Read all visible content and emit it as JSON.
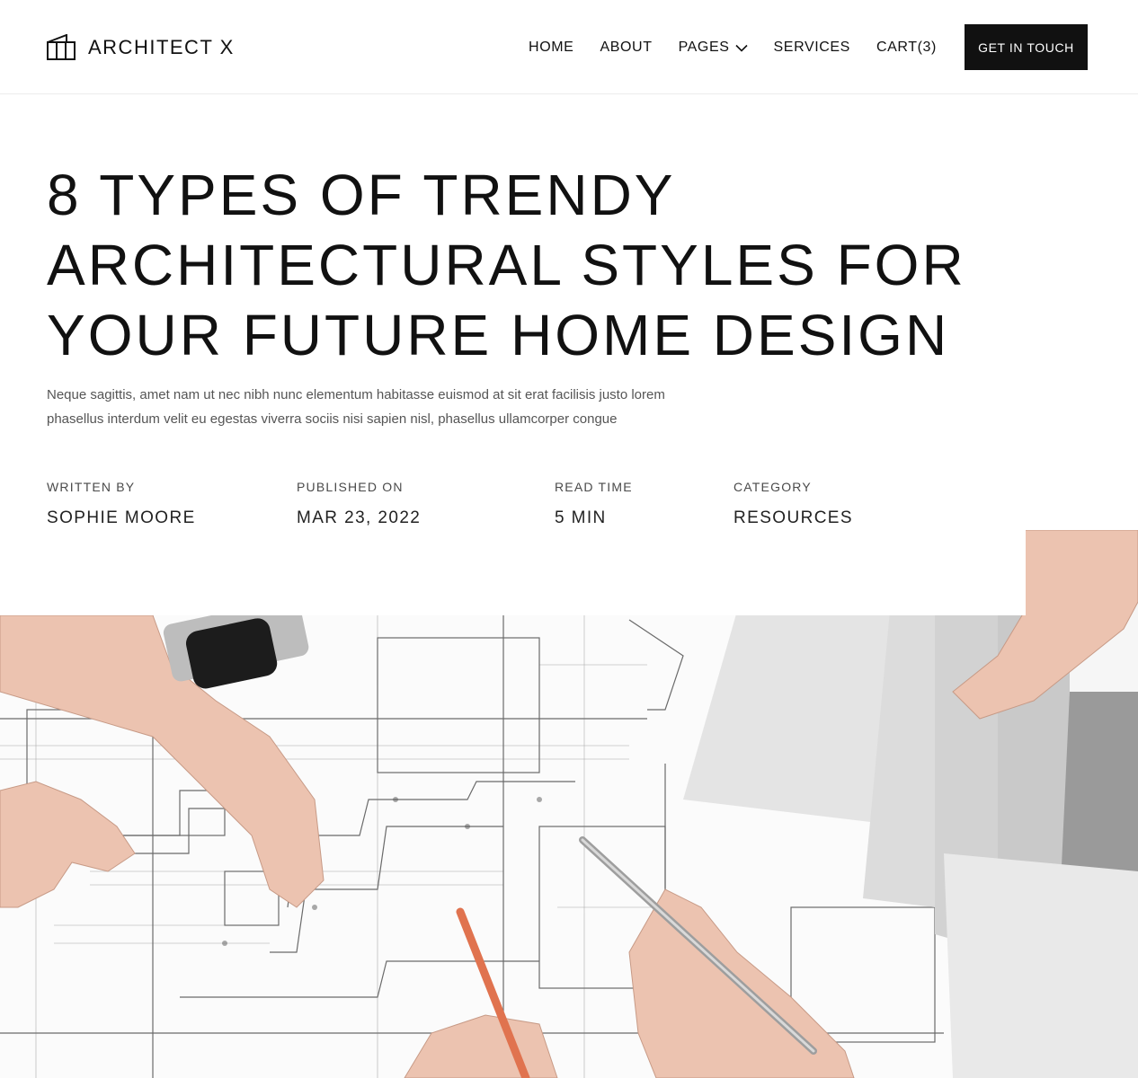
{
  "brand": {
    "name": "ARCHITECT X",
    "icon": "building-icon"
  },
  "nav": {
    "items": [
      {
        "label": "HOME"
      },
      {
        "label": "ABOUT"
      },
      {
        "label": "PAGES",
        "icon": "chevron-down-icon"
      },
      {
        "label": "SERVICES"
      },
      {
        "label": "CART(3)"
      }
    ],
    "cta": "GET IN TOUCH"
  },
  "article": {
    "title_lines": [
      "8 TYPES OF TRENDY",
      "ARCHITECTURAL STYLES FOR",
      "YOUR FUTURE HOME DESIGN"
    ],
    "lead_lines": [
      "Neque sagittis, amet nam ut nec nibh nunc elementum habitasse euismod at sit erat facilisis justo lorem",
      "phasellus interdum velit eu egestas viverra sociis nisi sapien nisl, phasellus ullamcorper congue"
    ],
    "meta": [
      {
        "label": "WRITTEN BY",
        "value": "SOPHIE MOORE"
      },
      {
        "label": "PUBLISHED ON",
        "value": "MAR 23, 2022"
      },
      {
        "label": "READ TIME",
        "value": "5 MIN"
      },
      {
        "label": "CATEGORY",
        "value": "RESOURCES"
      }
    ]
  },
  "colors": {
    "text": "#111111",
    "muted": "#555555",
    "cta_bg": "#111111",
    "cta_text": "#ffffff",
    "divider": "#ececec",
    "pencil": "#e0734f"
  }
}
